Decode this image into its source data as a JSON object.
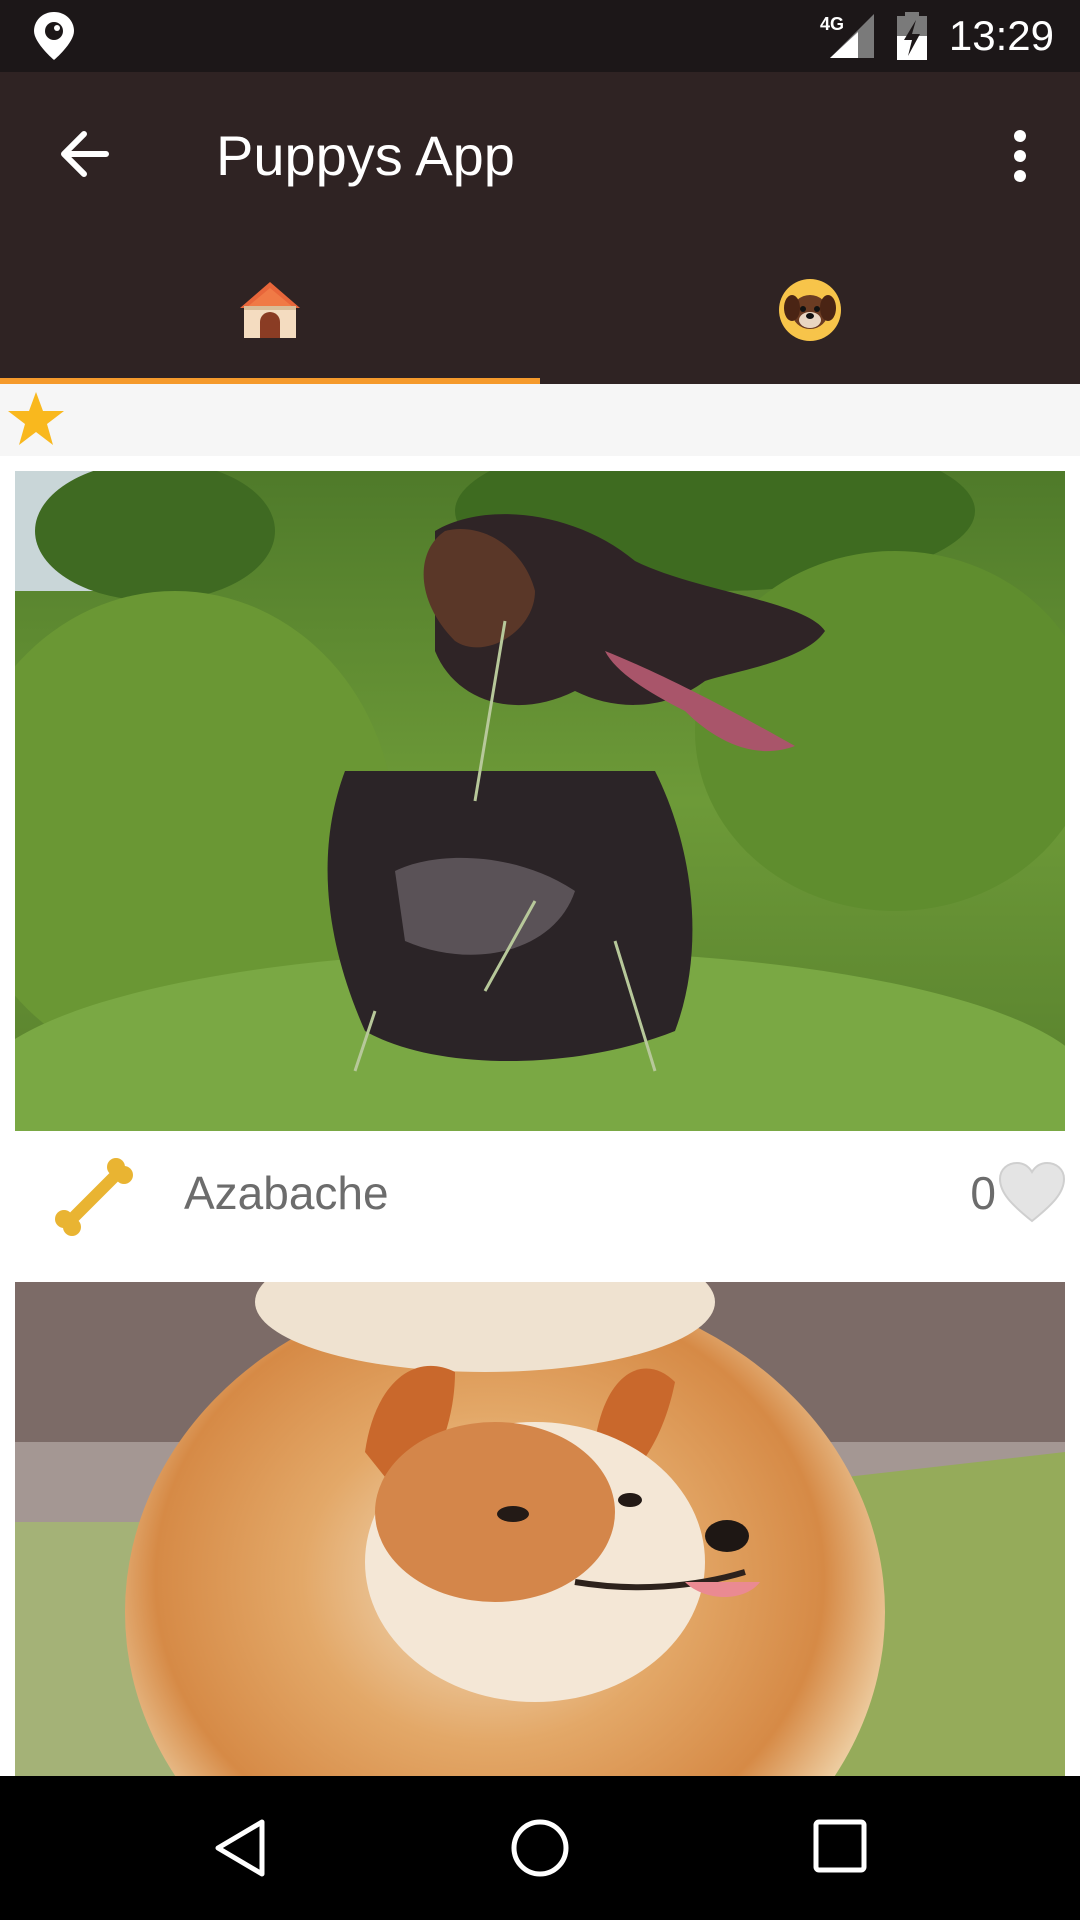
{
  "status_bar": {
    "time": "13:29",
    "network": "4G",
    "icons": [
      "location-icon",
      "signal-icon",
      "battery-charging-icon"
    ]
  },
  "app_bar": {
    "title": "Puppys App",
    "icons": [
      "arrow-back-icon",
      "more-vert-icon"
    ]
  },
  "tabs": [
    {
      "icon": "dog-house-icon",
      "selected": true
    },
    {
      "icon": "dog-face-icon",
      "selected": false
    }
  ],
  "filter_row": {
    "icon": "star-icon"
  },
  "cards": [
    {
      "name": "Azabache",
      "likes": "0",
      "rating_icon": "bone-icon",
      "like_icon": "heart-icon",
      "photo": "black-dog-in-grass"
    },
    {
      "photo": "pomeranian-dog"
    }
  ],
  "colors": {
    "status_bar": "#1c1718",
    "app_bar": "#2f2323",
    "tab_indicator": "#f59a2c",
    "star": "#f9b81e",
    "text_secondary": "#6c6c6c"
  },
  "nav_bar": {
    "icons": [
      "nav-back-icon",
      "nav-home-icon",
      "nav-recents-icon"
    ]
  }
}
